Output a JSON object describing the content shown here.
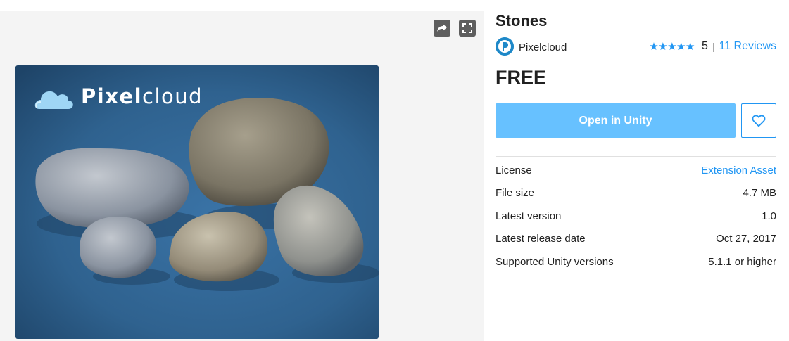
{
  "gallery": {
    "share_icon": "share-arrow-icon",
    "fullscreen_icon": "fullscreen-icon",
    "hero_brand_bold": "Pixel",
    "hero_brand_light": "cloud",
    "hero_logo_icon": "cloud-logo-icon"
  },
  "asset": {
    "title": "Stones",
    "publisher": "Pixelcloud",
    "rating_stars": 5,
    "rating_score": "5",
    "reviews_label": "11 Reviews",
    "price": "FREE",
    "open_button": "Open in Unity",
    "favorite_icon": "heart-outline-icon"
  },
  "details": [
    {
      "label": "License",
      "value": "Extension Asset",
      "link": true
    },
    {
      "label": "File size",
      "value": "4.7 MB",
      "link": false
    },
    {
      "label": "Latest version",
      "value": "1.0",
      "link": false
    },
    {
      "label": "Latest release date",
      "value": "Oct 27, 2017",
      "link": false
    },
    {
      "label": "Supported Unity versions",
      "value": "5.1.1 or higher",
      "link": false
    }
  ],
  "colors": {
    "accent": "#2196f3",
    "open_button_bg": "#67c1ff",
    "gallery_bg": "#f4f4f4",
    "hero_bg": "#2d5d87"
  }
}
